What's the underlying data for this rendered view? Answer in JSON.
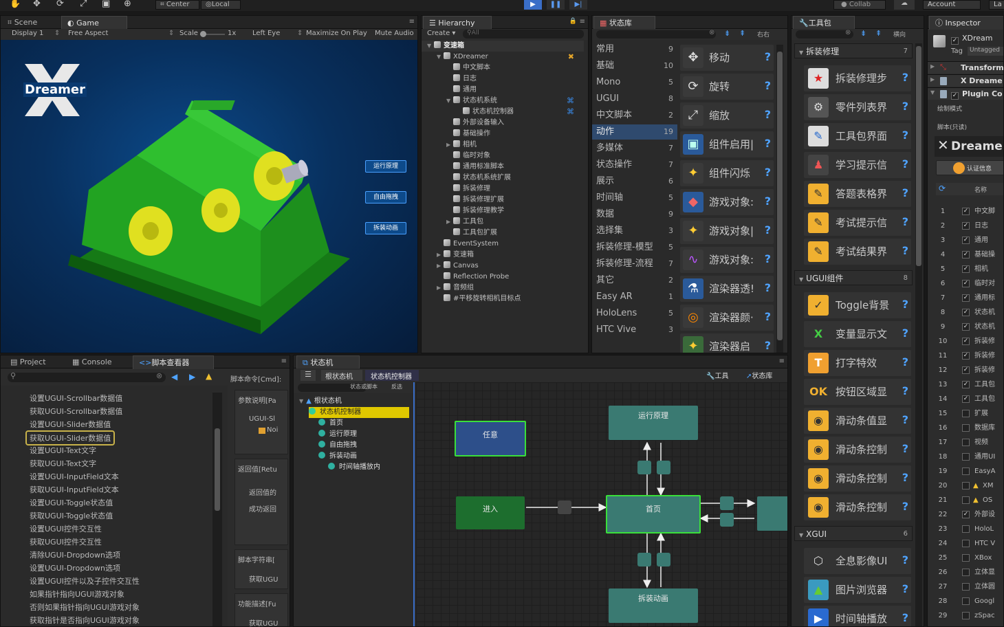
{
  "toolbar": {
    "center_label": "Center",
    "local_label": "Local",
    "collab_label": "Collab",
    "account_label": "Account",
    "layers_label": "La"
  },
  "scene_tabs": {
    "scene": "Scene",
    "game": "Game"
  },
  "game_toolbar": {
    "display": "Display 1",
    "aspect": "Free Aspect",
    "scale_label": "Scale",
    "scale_value": "1x",
    "left_eye": "Left Eye",
    "maximize": "Maximize On Play",
    "mute": "Mute Audio"
  },
  "game_view": {
    "logo_text": "Dreamer",
    "buttons": [
      "运行原理",
      "自由拖拽",
      "拆装动画"
    ]
  },
  "hierarchy": {
    "tab": "Hierarchy",
    "create": "Create",
    "search": "All",
    "rows": [
      {
        "label": "变速箱",
        "indent": 0,
        "tri": "▼",
        "bold": true
      },
      {
        "label": "XDreamer",
        "indent": 1,
        "tri": "▼",
        "x": true
      },
      {
        "label": "中文脚本",
        "indent": 2,
        "tri": ""
      },
      {
        "label": "日志",
        "indent": 2,
        "tri": ""
      },
      {
        "label": "通用",
        "indent": 2,
        "tri": ""
      },
      {
        "label": "状态机系统",
        "indent": 2,
        "tri": "▼",
        "link": true
      },
      {
        "label": "状态机控制器",
        "indent": 3,
        "tri": "",
        "link": true
      },
      {
        "label": "外部设备输入",
        "indent": 2,
        "tri": ""
      },
      {
        "label": "基础操作",
        "indent": 2,
        "tri": ""
      },
      {
        "label": "相机",
        "indent": 2,
        "tri": "▶"
      },
      {
        "label": "临时对象",
        "indent": 2,
        "tri": ""
      },
      {
        "label": "通用标准脚本",
        "indent": 2,
        "tri": ""
      },
      {
        "label": "状态机系统扩展",
        "indent": 2,
        "tri": ""
      },
      {
        "label": "拆装修理",
        "indent": 2,
        "tri": ""
      },
      {
        "label": "拆装修理扩展",
        "indent": 2,
        "tri": ""
      },
      {
        "label": "拆装修理教学",
        "indent": 2,
        "tri": ""
      },
      {
        "label": "工具包",
        "indent": 2,
        "tri": "▶"
      },
      {
        "label": "工具包扩展",
        "indent": 2,
        "tri": ""
      },
      {
        "label": "EventSystem",
        "indent": 1,
        "tri": ""
      },
      {
        "label": "变速箱",
        "indent": 1,
        "tri": "▶"
      },
      {
        "label": "Canvas",
        "indent": 1,
        "tri": "▶"
      },
      {
        "label": "Reflection Probe",
        "indent": 1,
        "tri": ""
      },
      {
        "label": "音频组",
        "indent": 1,
        "tri": "▶"
      },
      {
        "label": "#平移旋转相机目标点",
        "indent": 1,
        "tri": ""
      }
    ]
  },
  "state_library": {
    "tab": "状态库",
    "search_suffix": "右右",
    "categories": [
      {
        "name": "常用",
        "count": "9"
      },
      {
        "name": "基础",
        "count": "10"
      },
      {
        "name": "Mono",
        "count": "5"
      },
      {
        "name": "UGUI",
        "count": "8"
      },
      {
        "name": "中文脚本",
        "count": "2"
      },
      {
        "name": "动作",
        "count": "19",
        "selected": true
      },
      {
        "name": "多媒体",
        "count": "7"
      },
      {
        "name": "状态操作",
        "count": "7"
      },
      {
        "name": "展示",
        "count": "6"
      },
      {
        "name": "时间轴",
        "count": "5"
      },
      {
        "name": "数据",
        "count": "9"
      },
      {
        "name": "选择集",
        "count": "3"
      },
      {
        "name": "拆装修理-模型",
        "count": "5"
      },
      {
        "name": "拆装修理-流程",
        "count": "7"
      },
      {
        "name": "其它",
        "count": "2"
      },
      {
        "name": "Easy AR",
        "count": "1"
      },
      {
        "name": "HoloLens",
        "count": "5"
      },
      {
        "name": "HTC Vive",
        "count": "3"
      }
    ],
    "items": [
      {
        "label": "移动",
        "icon": "move-icon",
        "glyph": "✥",
        "bg": "#3a3a3a",
        "fg": "#ddd"
      },
      {
        "label": "旋转",
        "icon": "rotate-icon",
        "glyph": "⟳",
        "bg": "#3a3a3a",
        "fg": "#ddd"
      },
      {
        "label": "缩放",
        "icon": "scale-icon",
        "glyph": "⤢",
        "bg": "#3a3a3a",
        "fg": "#ddd"
      },
      {
        "label": "组件启用|",
        "icon": "component-icon",
        "glyph": "▣",
        "bg": "#2a5a9a",
        "fg": "#bfe"
      },
      {
        "label": "组件闪烁",
        "icon": "sparkle-icon",
        "glyph": "✦",
        "bg": "#3a3a3a",
        "fg": "#ffcc33"
      },
      {
        "label": "游戏对象:",
        "icon": "cube-icon",
        "glyph": "◆",
        "bg": "#2a5a9a",
        "fg": "#e66"
      },
      {
        "label": "游戏对象|",
        "icon": "sparkle-icon",
        "glyph": "✦",
        "bg": "#3a3a3a",
        "fg": "#ffcc33"
      },
      {
        "label": "游戏对象:",
        "icon": "curve-icon",
        "glyph": "∿",
        "bg": "#3a3a3a",
        "fg": "#b5f"
      },
      {
        "label": "渲染器透!",
        "icon": "flask-icon",
        "glyph": "⚗",
        "bg": "#2a5a9a",
        "fg": "#fff"
      },
      {
        "label": "渲染器颜·",
        "icon": "color-wheel-icon",
        "glyph": "◎",
        "bg": "#3a3a3a",
        "fg": "#f80"
      },
      {
        "label": "渲染器启",
        "icon": "sparkle-icon",
        "glyph": "✦",
        "bg": "#3a6a3a",
        "fg": "#fc3"
      }
    ]
  },
  "toolkit": {
    "tab": "工具包",
    "search_suffix": "横向",
    "sections": [
      {
        "title": "拆装修理",
        "count": "7",
        "items": [
          {
            "label": "拆装修理步",
            "icon": "star-flag-icon",
            "glyph": "★",
            "bg": "#ddd",
            "fg": "#d22"
          },
          {
            "label": "零件列表界",
            "icon": "gear-icon",
            "glyph": "⚙",
            "bg": "#555",
            "fg": "#ddd"
          },
          {
            "label": "工具包界面",
            "icon": "calendar-edit-icon",
            "glyph": "✎",
            "bg": "#ddd",
            "fg": "#26c"
          },
          {
            "label": "学习提示信",
            "icon": "person-icon",
            "glyph": "♟",
            "bg": "#444",
            "fg": "#e55"
          },
          {
            "label": "答题表格界",
            "icon": "note-icon",
            "glyph": "✎",
            "bg": "#f0b030",
            "fg": "#333"
          },
          {
            "label": "考试提示信",
            "icon": "note-icon",
            "glyph": "✎",
            "bg": "#f0b030",
            "fg": "#333"
          },
          {
            "label": "考试结果界",
            "icon": "note-icon",
            "glyph": "✎",
            "bg": "#f0b030",
            "fg": "#333"
          }
        ]
      },
      {
        "title": "UGUI组件",
        "count": "8",
        "items": [
          {
            "label": "Toggle背景",
            "icon": "checkbox-icon",
            "glyph": "✓",
            "bg": "#f0b030",
            "fg": "#333"
          },
          {
            "label": "变量显示文",
            "icon": "variable-icon",
            "glyph": "X",
            "bg": "#333",
            "fg": "#4c4"
          },
          {
            "label": "打字特效",
            "icon": "text-icon",
            "glyph": "T",
            "bg": "#f0a030",
            "fg": "#fff"
          },
          {
            "label": "按钮区域显",
            "icon": "ok-button-icon",
            "glyph": "OK",
            "bg": "#333",
            "fg": "#f0b030"
          },
          {
            "label": "滑动条值显",
            "icon": "eye-icon",
            "glyph": "◉",
            "bg": "#f0b030",
            "fg": "#333"
          },
          {
            "label": "滑动条控制",
            "icon": "eye-icon",
            "glyph": "◉",
            "bg": "#f0b030",
            "fg": "#333"
          },
          {
            "label": "滑动条控制",
            "icon": "eye-icon",
            "glyph": "◉",
            "bg": "#f0b030",
            "fg": "#333"
          },
          {
            "label": "滑动条控制",
            "icon": "eye-icon",
            "glyph": "◉",
            "bg": "#f0b030",
            "fg": "#333"
          }
        ]
      },
      {
        "title": "XGUI",
        "count": "6",
        "items": [
          {
            "label": "全息影像UI",
            "icon": "hologram-icon",
            "glyph": "⬡",
            "bg": "#333",
            "fg": "#ddd"
          },
          {
            "label": "图片浏览器",
            "icon": "image-icon",
            "glyph": "▲",
            "bg": "#3a9ac0",
            "fg": "#6c3"
          },
          {
            "label": "时间轴播放",
            "icon": "play-icon",
            "glyph": "▶",
            "bg": "#2a6ad0",
            "fg": "#fff"
          }
        ]
      }
    ]
  },
  "inspector": {
    "tab": "Inspector",
    "obj_name": "XDream",
    "tag_label": "Tag",
    "tag_value": "Untagged",
    "components": [
      "Transform",
      "X Dreame",
      "Plugin Co"
    ],
    "draw_mode": "绘制模式",
    "script_ro": "脚本(只读)",
    "brand": "Dreame",
    "auth_btn": "认证信息",
    "col_name": "名称",
    "rows": [
      {
        "n": "1",
        "c": true,
        "t": "中文脚"
      },
      {
        "n": "2",
        "c": true,
        "t": "日志"
      },
      {
        "n": "3",
        "c": true,
        "t": "通用"
      },
      {
        "n": "4",
        "c": true,
        "t": "基础操"
      },
      {
        "n": "5",
        "c": true,
        "t": "相机"
      },
      {
        "n": "6",
        "c": true,
        "t": "临时对"
      },
      {
        "n": "7",
        "c": true,
        "t": "通用标"
      },
      {
        "n": "8",
        "c": true,
        "t": "状态机"
      },
      {
        "n": "9",
        "c": true,
        "t": "状态机"
      },
      {
        "n": "10",
        "c": true,
        "t": "拆装修"
      },
      {
        "n": "11",
        "c": true,
        "t": "拆装修"
      },
      {
        "n": "12",
        "c": true,
        "t": "拆装修"
      },
      {
        "n": "13",
        "c": true,
        "t": "工具包"
      },
      {
        "n": "14",
        "c": true,
        "t": "工具包"
      },
      {
        "n": "15",
        "c": false,
        "t": "扩展"
      },
      {
        "n": "16",
        "c": false,
        "t": "数据库"
      },
      {
        "n": "17",
        "c": false,
        "t": "视频"
      },
      {
        "n": "18",
        "c": false,
        "t": "通用UI"
      },
      {
        "n": "19",
        "c": false,
        "t": "EasyA"
      },
      {
        "n": "20",
        "c": false,
        "t": "XM",
        "warn": true
      },
      {
        "n": "21",
        "c": false,
        "t": "OS",
        "warn": true
      },
      {
        "n": "22",
        "c": true,
        "t": "外部设"
      },
      {
        "n": "23",
        "c": false,
        "t": "HoloL"
      },
      {
        "n": "24",
        "c": false,
        "t": "HTC V"
      },
      {
        "n": "25",
        "c": false,
        "t": "XBox"
      },
      {
        "n": "26",
        "c": false,
        "t": "立体显"
      },
      {
        "n": "27",
        "c": false,
        "t": "立体圆"
      },
      {
        "n": "28",
        "c": false,
        "t": "Googl"
      },
      {
        "n": "29",
        "c": false,
        "t": "zSpac"
      }
    ]
  },
  "bottom_tabs": {
    "project": "Project",
    "console": "Console",
    "script_viewer": "脚本查看器"
  },
  "script_list": [
    "设置UGUI-Scrollbar数据值",
    "获取UGUI-Scrollbar数据值",
    "设置UGUI-Slider数据值",
    "获取UGUI-Slider数据值",
    "设置UGUI-Text文字",
    "获取UGUI-Text文字",
    "设置UGUI-InputField文本",
    "获取UGUI-InputField文本",
    "设置UGUI-Toggle状态值",
    "获取UGUI-Toggle状态值",
    "设置UGUI控件交互性",
    "获取UGUI控件交互性",
    "清除UGUI-Dropdown选项",
    "设置UGUI-Dropdown选项",
    "设置UGUI控件以及子控件交互性",
    "如果指针指向UGUI游戏对象",
    "否则如果指针指向UGUI游戏对象",
    "获取指针是否指向UGUI游戏对象"
  ],
  "script_detail": {
    "cmd": "脚本命令[Cmd]:",
    "params": "参数说明[Pa",
    "ugui": "UGUI-Sl",
    "noi": "Noi",
    "ret": "返回值[Retu",
    "ret_val": "返回值的",
    "success": "成功返回",
    "str": "脚本字符串[",
    "get": "获取UGU",
    "func": "功能描述[Fu",
    "get2": "获取UGU"
  },
  "state_machine": {
    "tab": "状态机",
    "breadcrumb_root": "根状态机",
    "breadcrumb_current": "状态机控制器",
    "filter": "状态或脚本",
    "filter2": "反选",
    "tool_btn": "工具",
    "lib_btn": "状态库",
    "tree": [
      {
        "label": "根状态机",
        "indent": 0,
        "type": "root"
      },
      {
        "label": "状态机控制器",
        "indent": 1,
        "type": "sm",
        "selected": true
      },
      {
        "label": "首页",
        "indent": 2,
        "type": "state"
      },
      {
        "label": "运行原理",
        "indent": 2,
        "type": "state"
      },
      {
        "label": "自由拖拽",
        "indent": 2,
        "type": "state"
      },
      {
        "label": "拆装动画",
        "indent": 2,
        "type": "state"
      },
      {
        "label": "时间轴播放内",
        "indent": 3,
        "type": "state"
      }
    ],
    "nodes": {
      "any": "任意",
      "entry": "进入",
      "home": "首页",
      "run": "运行原理",
      "disasm": "拆装动画"
    }
  }
}
